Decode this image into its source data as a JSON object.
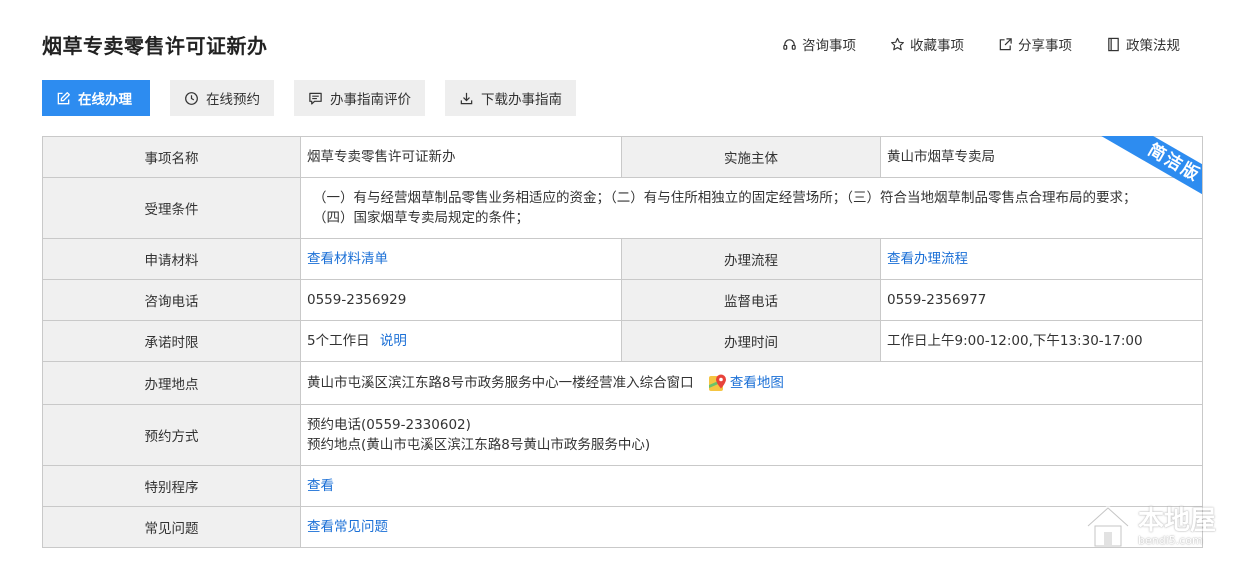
{
  "page": {
    "title": "烟草专卖零售许可证新办"
  },
  "top_actions": [
    {
      "label": "咨询事项",
      "icon": "headset-icon"
    },
    {
      "label": "收藏事项",
      "icon": "star-icon"
    },
    {
      "label": "分享事项",
      "icon": "share-icon"
    },
    {
      "label": "政策法规",
      "icon": "book-icon"
    }
  ],
  "buttons": {
    "online_handle": "在线办理",
    "online_booking": "在线预约",
    "guide_review": "办事指南评价",
    "download_guide": "下载办事指南"
  },
  "badge": "简洁版",
  "table": {
    "item_name_label": "事项名称",
    "item_name": "烟草专卖零售许可证新办",
    "implementer_label": "实施主体",
    "implementer": "黄山市烟草专卖局",
    "conditions_label": "受理条件",
    "conditions_line1": "（一）有与经营烟草制品零售业务相适应的资金；（二）有与住所相独立的固定经营场所；（三）符合当地烟草制品零售点合理布局的要求；",
    "conditions_line2": "（四）国家烟草专卖局规定的条件；",
    "materials_label": "申请材料",
    "materials_link": "查看材料清单",
    "process_label": "办理流程",
    "process_link": "查看办理流程",
    "consult_phone_label": "咨询电话",
    "consult_phone": "0559-2356929",
    "supervise_phone_label": "监督电话",
    "supervise_phone": "0559-2356977",
    "time_limit_label": "承诺时限",
    "time_limit": "5个工作日",
    "time_limit_note": "说明",
    "office_hours_label": "办理时间",
    "office_hours": "工作日上午9:00-12:00,下午13:30-17:00",
    "location_label": "办理地点",
    "location": "黄山市屯溪区滨江东路8号市政务服务中心一楼经营准入综合窗口",
    "map_link": "查看地图",
    "booking_label": "预约方式",
    "booking_phone": "预约电话(0559-2330602)",
    "booking_place": "预约地点(黄山市屯溪区滨江东路8号黄山市政务服务中心)",
    "special_label": "特别程序",
    "special_link": "查看",
    "faq_label": "常见问题",
    "faq_link": "查看常见问题"
  },
  "watermark": {
    "brand": "本地屋",
    "url": "bendi5.com"
  },
  "colors": {
    "primary": "#2d8cf0",
    "link": "#1a6fd6",
    "label_bg": "#f0f0f0"
  }
}
